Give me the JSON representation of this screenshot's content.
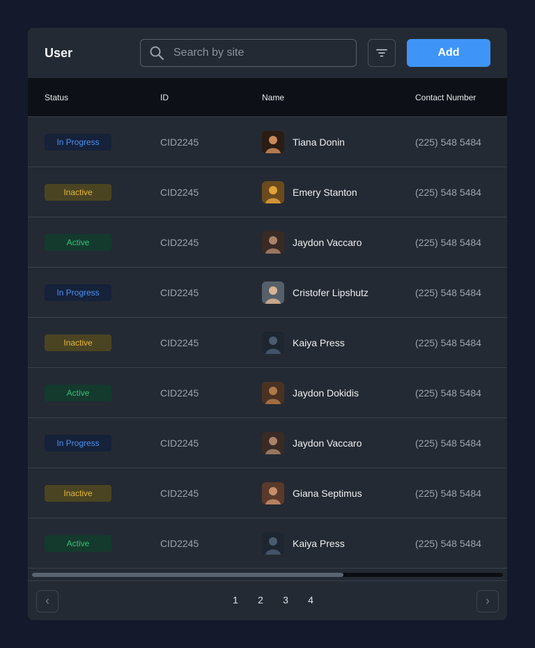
{
  "header": {
    "title": "User",
    "search_placeholder": "Search by site",
    "search_value": "",
    "add_label": "Add"
  },
  "table": {
    "columns": [
      "Status",
      "ID",
      "Name",
      "Contact Number"
    ],
    "rows": [
      {
        "status": "In Progress",
        "status_kind": "progress",
        "id": "CID2245",
        "name": "Tiana Donin",
        "phone": "(225) 548 5484"
      },
      {
        "status": "Inactive",
        "status_kind": "inactive",
        "id": "CID2245",
        "name": "Emery Stanton",
        "phone": "(225) 548 5484"
      },
      {
        "status": "Active",
        "status_kind": "active",
        "id": "CID2245",
        "name": "Jaydon Vaccaro",
        "phone": "(225) 548 5484"
      },
      {
        "status": "In Progress",
        "status_kind": "progress",
        "id": "CID2245",
        "name": "Cristofer Lipshutz",
        "phone": "(225) 548 5484"
      },
      {
        "status": "Inactive",
        "status_kind": "inactive",
        "id": "CID2245",
        "name": "Kaiya Press",
        "phone": "(225) 548 5484"
      },
      {
        "status": "Active",
        "status_kind": "active",
        "id": "CID2245",
        "name": "Jaydon Dokidis",
        "phone": "(225) 548 5484"
      },
      {
        "status": "In Progress",
        "status_kind": "progress",
        "id": "CID2245",
        "name": "Jaydon Vaccaro",
        "phone": "(225) 548 5484"
      },
      {
        "status": "Inactive",
        "status_kind": "inactive",
        "id": "CID2245",
        "name": "Giana Septimus",
        "phone": "(225) 548 5484"
      },
      {
        "status": "Active",
        "status_kind": "active",
        "id": "CID2245",
        "name": "Kaiya Press",
        "phone": "(225) 548 5484"
      }
    ]
  },
  "pagination": {
    "pages": [
      "1",
      "2",
      "3",
      "4"
    ]
  },
  "colors": {
    "accent": "#3f95f7",
    "progress": "#4b93f1",
    "inactive": "#e3b73b",
    "active": "#2fc37a"
  },
  "icons": {
    "search": "search-icon",
    "filter": "filter-icon",
    "prev": "chevron-left-icon",
    "next": "chevron-right-icon"
  }
}
